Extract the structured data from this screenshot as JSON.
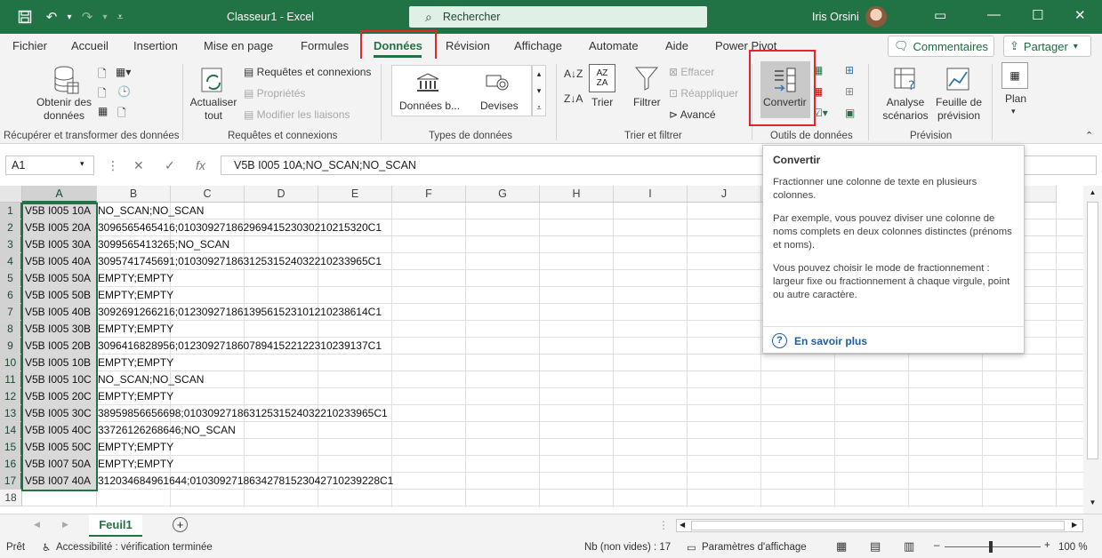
{
  "titlebar": {
    "title": "Classeur1 - Excel",
    "search_placeholder": "Rechercher",
    "user": "Iris Orsini"
  },
  "menu": {
    "tabs": [
      "Fichier",
      "Accueil",
      "Insertion",
      "Mise en page",
      "Formules",
      "Données",
      "Révision",
      "Affichage",
      "Automate",
      "Aide",
      "Power Pivot"
    ],
    "active_tab": "Données",
    "comments_label": "Commentaires",
    "share_label": "Partager"
  },
  "ribbon": {
    "get_data_label": "Obtenir des données",
    "group_get_transform": "Récupérer et transformer des données",
    "refresh_all_label": "Actualiser tout",
    "queries_connections": "Requêtes et connexions",
    "properties": "Propriétés",
    "edit_links": "Modifier les liaisons",
    "group_queries": "Requêtes et connexions",
    "datatype_stocks": "Données b...",
    "datatype_currencies": "Devises",
    "group_datatypes": "Types de données",
    "sort_label": "Trier",
    "filter_label": "Filtrer",
    "clear_label": "Effacer",
    "reapply_label": "Réappliquer",
    "advanced_label": "Avancé",
    "group_sort_filter": "Trier et filtrer",
    "convert_label": "Convertir",
    "group_data_tools": "Outils de données",
    "whatif_label": "Analyse scénarios",
    "forecast_label": "Feuille de prévision",
    "group_forecast": "Prévision",
    "outline_label": "Plan"
  },
  "formula": {
    "namebox": "A1",
    "content": "V5B I005 10A;NO_SCAN;NO_SCAN"
  },
  "grid": {
    "columns": [
      "A",
      "B",
      "C",
      "D",
      "E",
      "F",
      "G",
      "H",
      "I",
      "J",
      "K",
      "L",
      "M",
      "N"
    ],
    "rows": [
      {
        "n": "1",
        "a": "V5B I005 10A",
        "b": "NO_SCAN;NO_SCAN"
      },
      {
        "n": "2",
        "a": "V5B I005 20A",
        "b": "3096565465416;0103092718629694152303021021 5320C1"
      },
      {
        "n": "3",
        "a": "V5B I005 30A",
        "b": "3099565413265;NO_SCAN"
      },
      {
        "n": "4",
        "a": "V5B I005 40A",
        "b": "3095741745691;0103092718631253152403221023 3965C1"
      },
      {
        "n": "5",
        "a": "V5B I005 50A",
        "b": "EMPTY;EMPTY"
      },
      {
        "n": "6",
        "a": "V5B I005 50B",
        "b": "EMPTY;EMPTY"
      },
      {
        "n": "7",
        "a": "V5B I005 40B",
        "b": "3092691266216;0123092718613956152310121023 8614C1"
      },
      {
        "n": "8",
        "a": "V5B I005 30B",
        "b": "EMPTY;EMPTY"
      },
      {
        "n": "9",
        "a": "V5B I005 20B",
        "b": "3096416828956;0123092718607894152212231023 9137C1"
      },
      {
        "n": "10",
        "a": "V5B I005 10B",
        "b": "EMPTY;EMPTY"
      },
      {
        "n": "11",
        "a": "V5B I005 10C",
        "b": "NO_SCAN;NO_SCAN"
      },
      {
        "n": "12",
        "a": "V5B I005 20C",
        "b": "EMPTY;EMPTY"
      },
      {
        "n": "13",
        "a": "V5B I005 30C",
        "b": "38959856656698;010309271863125315240322102 33965C1"
      },
      {
        "n": "14",
        "a": "V5B I005 40C",
        "b": "33726126268646;NO_SCAN"
      },
      {
        "n": "15",
        "a": "V5B I005 50C",
        "b": "EMPTY;EMPTY"
      },
      {
        "n": "16",
        "a": "V5B I007 50A",
        "b": "EMPTY;EMPTY"
      },
      {
        "n": "17",
        "a": "V5B I007 40A",
        "b": "312034684961644;01030927186342781523042710 239228C1"
      },
      {
        "n": "18",
        "a": "",
        "b": ""
      }
    ]
  },
  "tooltip": {
    "title": "Convertir",
    "p1": "Fractionner une colonne de texte en plusieurs colonnes.",
    "p2": "Par exemple, vous pouvez diviser une colonne de noms complets en deux colonnes distinctes (prénoms et noms).",
    "p3": "Vous pouvez choisir le mode de fractionnement : largeur fixe ou fractionnement à chaque virgule, point ou autre caractère.",
    "link": "En savoir plus"
  },
  "sheets": {
    "active": "Feuil1"
  },
  "status": {
    "ready": "Prêt",
    "accessibility": "Accessibilité : vérification terminée",
    "count": "Nb (non vides) : 17",
    "display_settings": "Paramètres d'affichage",
    "zoom": "100 %"
  },
  "colors": {
    "excel_green": "#217346",
    "highlight_red": "#e0262b",
    "link_blue": "#1f5ca6"
  }
}
